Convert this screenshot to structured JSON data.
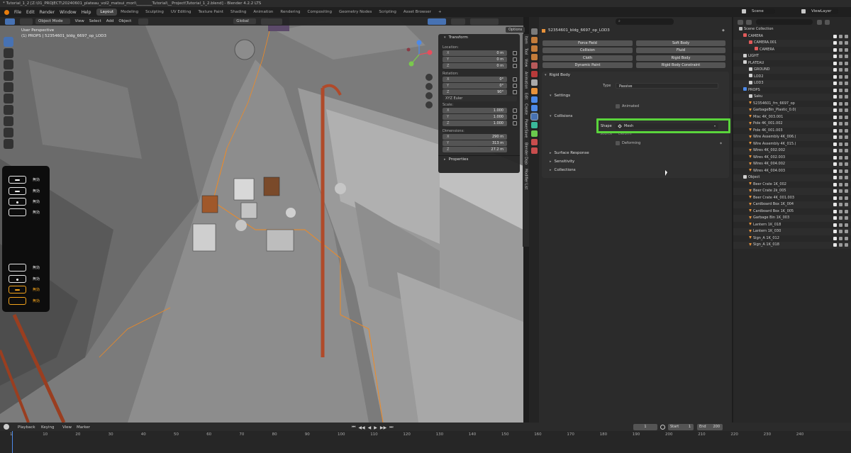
{
  "window": {
    "title": "* Tutorial_1_2 [Z:\\01_PROJECT\\20240601_plateau_vol2_matsui_mori\\________Tutorial\\__Project\\Tutorial_1_2.blend] - Blender 4.2.2 LTS"
  },
  "menu": [
    "File",
    "Edit",
    "Render",
    "Window",
    "Help"
  ],
  "workspaces": [
    "Layout",
    "Modeling",
    "Sculpting",
    "UV Editing",
    "Texture Paint",
    "Shading",
    "Animation",
    "Rendering",
    "Compositing",
    "Geometry Nodes",
    "Scripting",
    "Asset Browser"
  ],
  "workspace_add": "+",
  "scene": {
    "label": "Scene",
    "view_layer": "ViewLayer"
  },
  "viewport_header": {
    "mode": "Object Mode",
    "menus": [
      "View",
      "Select",
      "Add",
      "Object"
    ],
    "transform_orientation": "Global",
    "options": "Options"
  },
  "viewport_overlay": {
    "line1": "User Perspective",
    "line2": "(1) PROPS | 52354601_bldg_6697_op_LOD3"
  },
  "keyboard_overlay": {
    "rows": [
      {
        "label": "無効",
        "key": "pill"
      },
      {
        "label": "無効",
        "key": "pill"
      },
      {
        "label": "無効",
        "key": "dot"
      },
      {
        "label": "無効",
        "key": "blank"
      },
      {
        "label": "無効",
        "key": "blank"
      },
      {
        "label": "無効",
        "key": "dot"
      },
      {
        "label": "無効",
        "key": "pill",
        "active": true
      },
      {
        "label": "無効",
        "key": "blank",
        "active": true
      }
    ],
    "active_color": "#f3a31b"
  },
  "n_panel": {
    "title": "Transform",
    "location_label": "Location:",
    "location": [
      {
        "axis": "X",
        "value": "0 m"
      },
      {
        "axis": "Y",
        "value": "0 m"
      },
      {
        "axis": "Z",
        "value": "0 m"
      }
    ],
    "rotation_label": "Rotation:",
    "rotation": [
      {
        "axis": "X",
        "value": "0°"
      },
      {
        "axis": "Y",
        "value": "0°"
      },
      {
        "axis": "Z",
        "value": "90°"
      }
    ],
    "rotation_mode": "XYZ Euler",
    "scale_label": "Scale:",
    "scale": [
      {
        "axis": "X",
        "value": "1.000"
      },
      {
        "axis": "Y",
        "value": "1.000"
      },
      {
        "axis": "Z",
        "value": "1.000"
      }
    ],
    "dimensions_label": "Dimensions:",
    "dimensions": [
      {
        "axis": "X",
        "value": "290 m"
      },
      {
        "axis": "Y",
        "value": "313 m"
      },
      {
        "axis": "Z",
        "value": "27.2 m"
      }
    ],
    "properties": "Properties"
  },
  "viewport_tabs": [
    "Item",
    "Tool",
    "View",
    "Animation",
    "Edit",
    "Create",
    "PowerSave",
    "Blender Dojo",
    "Modifier List"
  ],
  "properties": {
    "object_name": "52354601_bldg_6697_op_LOD3",
    "physics_buttons": [
      {
        "label": "Force Field",
        "side": "left"
      },
      {
        "label": "Soft Body",
        "side": "right"
      },
      {
        "label": "Collision",
        "side": "left"
      },
      {
        "label": "Fluid",
        "side": "right"
      },
      {
        "label": "Cloth",
        "side": "left"
      },
      {
        "label": "Rigid Body",
        "side": "right"
      },
      {
        "label": "Dynamic Paint",
        "side": "left"
      },
      {
        "label": "Rigid Body Constraint",
        "side": "right"
      }
    ],
    "rigid_body": "Rigid Body",
    "type_label": "Type",
    "type_value": "Passive",
    "settings": "Settings",
    "animated": "Animated",
    "collisions": "Collisions",
    "shape_label": "Shape",
    "shape_value": "Mesh",
    "source_label": "Source",
    "source_value": "Deform",
    "deforming": "Deforming",
    "subsections": [
      "Surface Response",
      "Sensitivity",
      "Collections"
    ],
    "highlight_color": "#5ad43c"
  },
  "outliner": {
    "root": "Scene Collection",
    "rows": [
      {
        "name": "CAMERA",
        "indent": 1,
        "kind": "collection-red"
      },
      {
        "name": "CAMERA.001",
        "indent": 2,
        "kind": "collection-red"
      },
      {
        "name": "CAMERA",
        "indent": 3,
        "kind": "camera"
      },
      {
        "name": "LIGHT",
        "indent": 1,
        "kind": "collection"
      },
      {
        "name": "PLATEAU",
        "indent": 1,
        "kind": "collection"
      },
      {
        "name": "GROUND",
        "indent": 2,
        "kind": "collection"
      },
      {
        "name": "LOD2",
        "indent": 2,
        "kind": "collection"
      },
      {
        "name": "LOD3",
        "indent": 2,
        "kind": "collection"
      },
      {
        "name": "PROPS",
        "indent": 1,
        "kind": "collection-blue"
      },
      {
        "name": "Saku",
        "indent": 2,
        "kind": "collection"
      },
      {
        "name": "52354601_frn_6697_op",
        "indent": 2,
        "kind": "mesh"
      },
      {
        "name": "GarbageBin_Plastic_0.0(",
        "indent": 2,
        "kind": "mesh"
      },
      {
        "name": "Misc 4K_003.001",
        "indent": 2,
        "kind": "mesh"
      },
      {
        "name": "Pole 4K_001.002",
        "indent": 2,
        "kind": "mesh"
      },
      {
        "name": "Pole 4K_001.003",
        "indent": 2,
        "kind": "mesh"
      },
      {
        "name": "Wire Assembly 4K_006.(",
        "indent": 2,
        "kind": "mesh"
      },
      {
        "name": "Wire Assembly 4K_015.(",
        "indent": 2,
        "kind": "mesh"
      },
      {
        "name": "Wires 4K_002.002",
        "indent": 2,
        "kind": "mesh"
      },
      {
        "name": "Wires 4K_002.003",
        "indent": 2,
        "kind": "mesh"
      },
      {
        "name": "Wires 4K_004.002",
        "indent": 2,
        "kind": "mesh"
      },
      {
        "name": "Wires 4K_004.003",
        "indent": 2,
        "kind": "mesh"
      },
      {
        "name": "Object",
        "indent": 1,
        "kind": "collection"
      },
      {
        "name": "Beer Crate 1K_002",
        "indent": 2,
        "kind": "mesh"
      },
      {
        "name": "Beer Crate 2k_005",
        "indent": 2,
        "kind": "mesh"
      },
      {
        "name": "Beer Crate 4K_001.003",
        "indent": 2,
        "kind": "mesh"
      },
      {
        "name": "Cardboard Box 1K_004",
        "indent": 2,
        "kind": "mesh"
      },
      {
        "name": "Cardboard Box 1K_005",
        "indent": 2,
        "kind": "mesh"
      },
      {
        "name": "Garbage Bin 1K_003",
        "indent": 2,
        "kind": "mesh"
      },
      {
        "name": "Lantern 1K_018",
        "indent": 2,
        "kind": "mesh"
      },
      {
        "name": "Lantern 1K_030",
        "indent": 2,
        "kind": "mesh"
      },
      {
        "name": "Sign_A 1K_012",
        "indent": 2,
        "kind": "mesh"
      },
      {
        "name": "Sign_A 1K_018",
        "indent": 2,
        "kind": "mesh"
      }
    ]
  },
  "timeline": {
    "menus": [
      "Playback",
      "Keying",
      "View",
      "Marker"
    ],
    "current_frame": "1",
    "start_label": "Start",
    "start": "1",
    "end_label": "End",
    "end": "200",
    "ticks": [
      "1",
      "10",
      "20",
      "30",
      "40",
      "50",
      "60",
      "70",
      "80",
      "90",
      "100",
      "110",
      "120",
      "130",
      "140",
      "150",
      "160",
      "170",
      "180",
      "190",
      "200",
      "210",
      "220",
      "230",
      "240"
    ]
  }
}
